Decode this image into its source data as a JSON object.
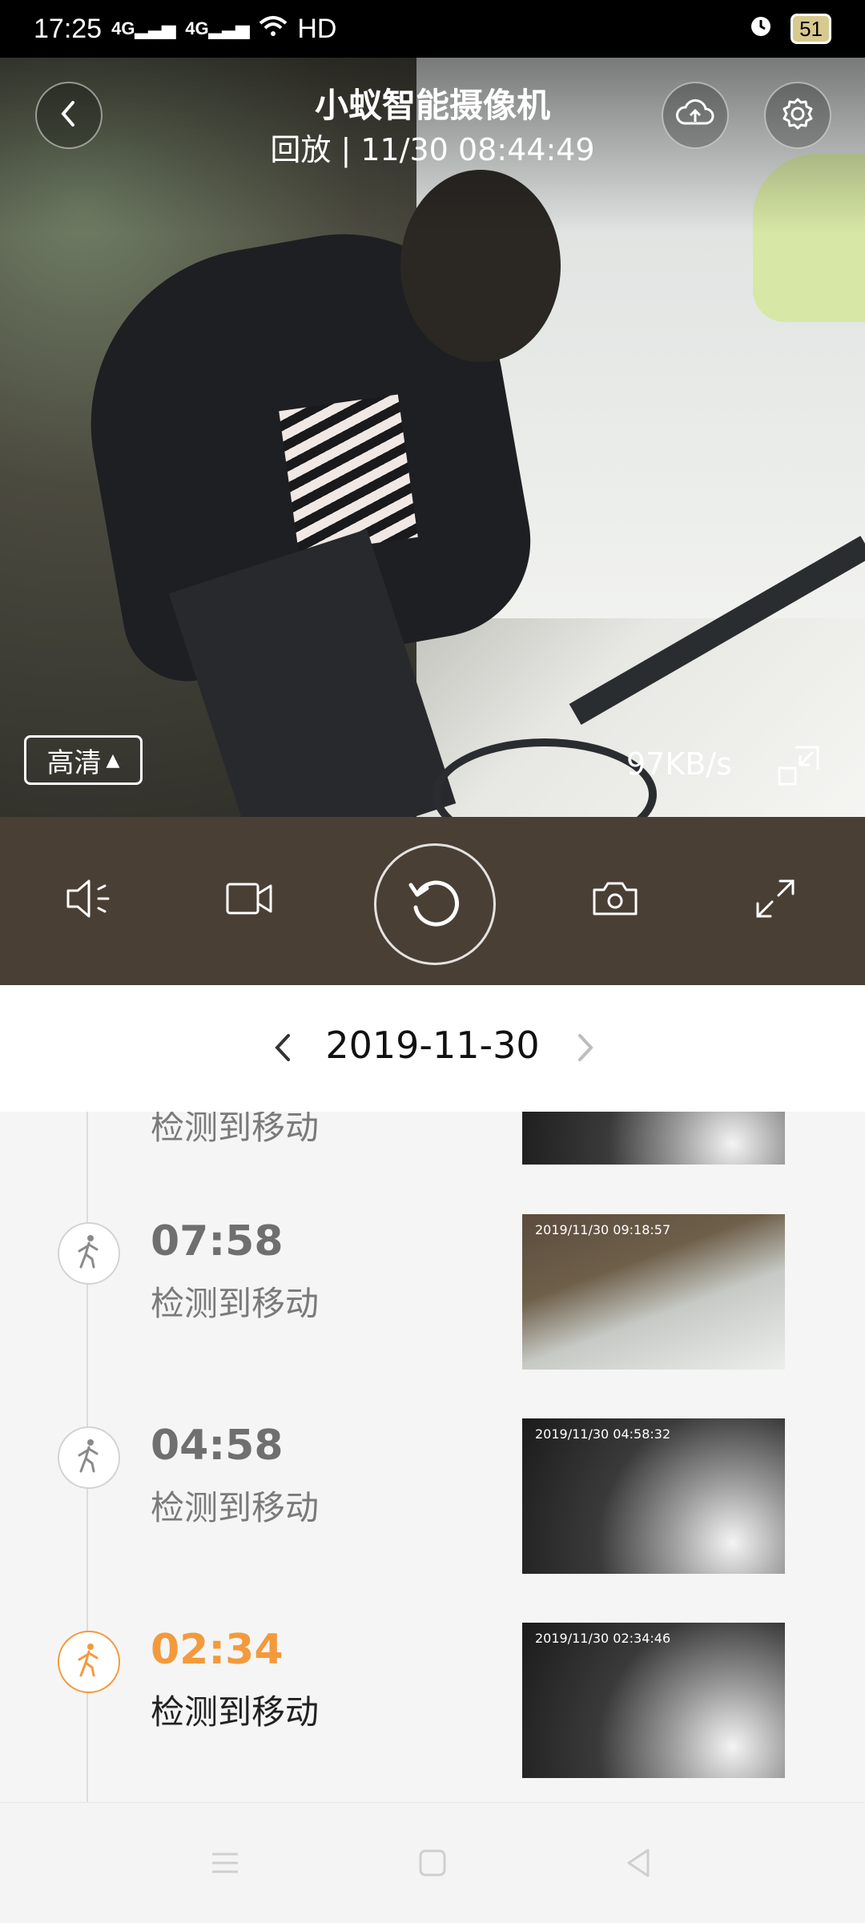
{
  "status_bar": {
    "time": "17:25",
    "signal1": "4G",
    "signal2": "4G",
    "wifi": "HD",
    "battery": "51"
  },
  "player": {
    "title": "小蚁智能摄像机",
    "subtitle": "回放 | 11/30 08:44:49",
    "quality": "高清",
    "speed": "97KB/s"
  },
  "date": "2019-11-30",
  "events": [
    {
      "time": "",
      "label": "检测到移动",
      "thumb_stamp": "",
      "active": false
    },
    {
      "time": "07:58",
      "label": "检测到移动",
      "thumb_stamp": "2019/11/30 09:18:57",
      "active": false
    },
    {
      "time": "04:58",
      "label": "检测到移动",
      "thumb_stamp": "2019/11/30 04:58:32",
      "active": false
    },
    {
      "time": "02:34",
      "label": "检测到移动",
      "thumb_stamp": "2019/11/30 02:34:46",
      "active": true
    }
  ],
  "colors": {
    "accent": "#f39a3c",
    "control_bar": "#4a3f35"
  },
  "icons": {
    "back": "chevron-left-icon",
    "cloud": "cloud-upload-icon",
    "settings": "gear-icon",
    "mute": "speaker-icon",
    "record": "video-camera-icon",
    "replay": "replay-icon",
    "snapshot": "camera-icon",
    "fullscreen": "expand-icon",
    "motion": "walking-person-icon"
  }
}
